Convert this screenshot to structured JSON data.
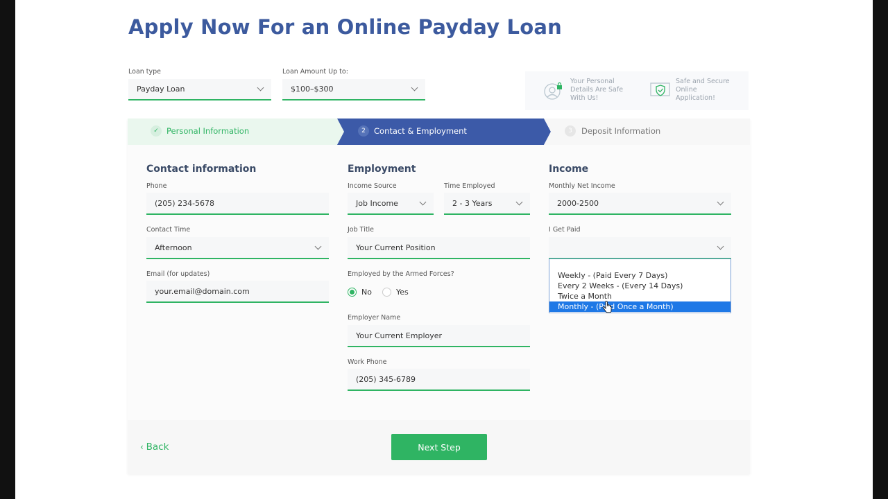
{
  "page": {
    "title": "Apply Now For an Online Payday Loan"
  },
  "top_fields": {
    "loan_type_label": "Loan type",
    "loan_type_value": "Payday Loan",
    "loan_amount_label": "Loan Amount Up to:",
    "loan_amount_value": "$100–$300"
  },
  "trust": {
    "personal_details": "Your Personal Details Are Safe With Us!",
    "secure_application": "Safe and Secure Online Application!"
  },
  "steps": [
    {
      "number": "✓",
      "label": "Personal Information",
      "state": "done"
    },
    {
      "number": "2",
      "label": "Contact & Employment",
      "state": "active"
    },
    {
      "number": "3",
      "label": "Deposit Information",
      "state": "pending"
    }
  ],
  "contact": {
    "heading": "Contact information",
    "phone_label": "Phone",
    "phone_value": "(205) 234-5678",
    "contact_time_label": "Contact Time",
    "contact_time_value": "Afternoon",
    "email_label": "Email (for updates)",
    "email_value": "your.email@domain.com"
  },
  "employment": {
    "heading": "Employment",
    "income_source_label": "Income Source",
    "income_source_value": "Job Income",
    "time_employed_label": "Time Employed",
    "time_employed_value": "2 - 3 Years",
    "job_title_label": "Job Title",
    "job_title_value": "Your Current Position",
    "armed_forces_label": "Employed by the Armed Forces?",
    "armed_forces_no": "No",
    "armed_forces_yes": "Yes",
    "employer_name_label": "Employer Name",
    "employer_name_value": "Your Current Employer",
    "work_phone_label": "Work Phone",
    "work_phone_value": "(205) 345-6789"
  },
  "income": {
    "heading": "Income",
    "monthly_net_label": "Monthly Net Income",
    "monthly_net_value": "2000-2500",
    "paid_label": "I Get Paid",
    "paid_value": "",
    "paid_options": [
      "Weekly - (Paid Every 7 Days)",
      "Every 2 Weeks - (Every 14 Days)",
      "Twice a Month",
      "Monthly - (Paid Once a Month)"
    ]
  },
  "footer": {
    "back_label": "Back",
    "next_label": "Next Step"
  },
  "colors": {
    "accent_green": "#2fb463",
    "brand_blue": "#3c5a9e",
    "highlight_blue": "#1e78e6"
  }
}
